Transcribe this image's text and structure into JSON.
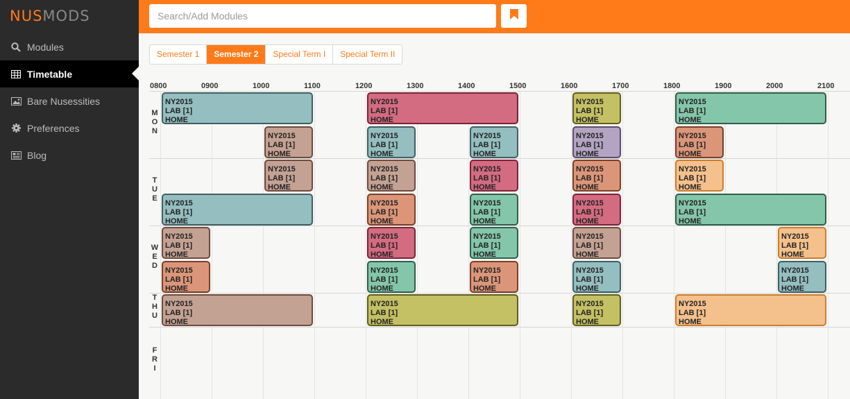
{
  "sidebar": {
    "brand": {
      "left": "NUS",
      "right": "MODS"
    },
    "items": [
      {
        "label": "Modules",
        "icon": "search-icon",
        "active": false
      },
      {
        "label": "Timetable",
        "icon": "table-icon",
        "active": true
      },
      {
        "label": "Bare Nusessities",
        "icon": "image-icon",
        "active": false
      },
      {
        "label": "Preferences",
        "icon": "gear-icon",
        "active": false
      },
      {
        "label": "Blog",
        "icon": "newspaper-icon",
        "active": false
      }
    ]
  },
  "topbar": {
    "search_placeholder": "Search/Add Modules",
    "bookmark_icon": "bookmark-icon",
    "accent": "#ff7b1a"
  },
  "tabs": [
    {
      "label": "Semester 1",
      "active": false
    },
    {
      "label": "Semester 2",
      "active": true
    },
    {
      "label": "Special Term I",
      "active": false
    },
    {
      "label": "Special Term II",
      "active": false
    }
  ],
  "timetable": {
    "hours": [
      "0800",
      "0900",
      "1000",
      "1100",
      "1200",
      "1300",
      "1400",
      "1500",
      "1600",
      "1700",
      "1800",
      "1900",
      "2000",
      "2100"
    ],
    "days": [
      {
        "label": "MON",
        "rows": 2
      },
      {
        "label": "TUE",
        "rows": 2
      },
      {
        "label": "WED",
        "rows": 2
      },
      {
        "label": "THU",
        "rows": 1
      },
      {
        "label": "FRI",
        "rows": 1
      }
    ],
    "lessons": [
      {
        "day": 0,
        "row": 0,
        "start": 800,
        "end": 1100,
        "color": "teal",
        "lines": [
          "NY2015",
          "LAB [1]",
          "HOME"
        ]
      },
      {
        "day": 0,
        "row": 0,
        "start": 1200,
        "end": 1500,
        "color": "red",
        "lines": [
          "NY2015",
          "LAB [1]",
          "HOME"
        ]
      },
      {
        "day": 0,
        "row": 0,
        "start": 1600,
        "end": 1700,
        "color": "olive",
        "lines": [
          "NY2015",
          "LAB [1]",
          "HOME"
        ]
      },
      {
        "day": 0,
        "row": 0,
        "start": 1800,
        "end": 2100,
        "color": "green",
        "lines": [
          "NY2015",
          "LAB [1]",
          "HOME"
        ]
      },
      {
        "day": 0,
        "row": 1,
        "start": 1000,
        "end": 1100,
        "color": "tan",
        "lines": [
          "NY2015",
          "LAB [1]",
          "HOME"
        ]
      },
      {
        "day": 0,
        "row": 1,
        "start": 1200,
        "end": 1300,
        "color": "teal",
        "lines": [
          "NY2015",
          "LAB [1]",
          "HOME"
        ]
      },
      {
        "day": 0,
        "row": 1,
        "start": 1400,
        "end": 1500,
        "color": "teal",
        "lines": [
          "NY2015",
          "LAB [1]",
          "HOME"
        ]
      },
      {
        "day": 0,
        "row": 1,
        "start": 1600,
        "end": 1700,
        "color": "purple",
        "lines": [
          "NY2015",
          "LAB [1]",
          "HOME"
        ]
      },
      {
        "day": 0,
        "row": 1,
        "start": 1800,
        "end": 1900,
        "color": "salmon",
        "lines": [
          "NY2015",
          "LAB [1]",
          "HOME"
        ]
      },
      {
        "day": 1,
        "row": 0,
        "start": 1000,
        "end": 1100,
        "color": "tan",
        "lines": [
          "NY2015",
          "LAB [1]",
          "HOME"
        ]
      },
      {
        "day": 1,
        "row": 0,
        "start": 1200,
        "end": 1300,
        "color": "tan",
        "lines": [
          "NY2015",
          "LAB [1]",
          "HOME"
        ]
      },
      {
        "day": 1,
        "row": 0,
        "start": 1400,
        "end": 1500,
        "color": "red",
        "lines": [
          "NY2015",
          "LAB [1]",
          "HOME"
        ]
      },
      {
        "day": 1,
        "row": 0,
        "start": 1600,
        "end": 1700,
        "color": "salmon",
        "lines": [
          "NY2015",
          "LAB [1]",
          "HOME"
        ]
      },
      {
        "day": 1,
        "row": 0,
        "start": 1800,
        "end": 1900,
        "color": "peach",
        "lines": [
          "NY2015",
          "LAB [1]",
          "HOME"
        ]
      },
      {
        "day": 1,
        "row": 1,
        "start": 800,
        "end": 1100,
        "color": "teal",
        "lines": [
          "NY2015",
          "LAB [1]",
          "HOME"
        ]
      },
      {
        "day": 1,
        "row": 1,
        "start": 1200,
        "end": 1300,
        "color": "salmon",
        "lines": [
          "NY2015",
          "LAB [1]",
          "HOME"
        ]
      },
      {
        "day": 1,
        "row": 1,
        "start": 1400,
        "end": 1500,
        "color": "green",
        "lines": [
          "NY2015",
          "LAB [1]",
          "HOME"
        ]
      },
      {
        "day": 1,
        "row": 1,
        "start": 1600,
        "end": 1700,
        "color": "red",
        "lines": [
          "NY2015",
          "LAB [1]",
          "HOME"
        ]
      },
      {
        "day": 1,
        "row": 1,
        "start": 1800,
        "end": 2100,
        "color": "green",
        "lines": [
          "NY2015",
          "LAB [1]",
          "HOME"
        ]
      },
      {
        "day": 2,
        "row": 0,
        "start": 800,
        "end": 900,
        "color": "tan",
        "lines": [
          "NY2015",
          "LAB [1]",
          "HOME"
        ]
      },
      {
        "day": 2,
        "row": 0,
        "start": 1200,
        "end": 1300,
        "color": "red",
        "lines": [
          "NY2015",
          "LAB [1]",
          "HOME"
        ]
      },
      {
        "day": 2,
        "row": 0,
        "start": 1400,
        "end": 1500,
        "color": "green",
        "lines": [
          "NY2015",
          "LAB [1]",
          "HOME"
        ]
      },
      {
        "day": 2,
        "row": 0,
        "start": 1600,
        "end": 1700,
        "color": "tan",
        "lines": [
          "NY2015",
          "LAB [1]",
          "HOME"
        ]
      },
      {
        "day": 2,
        "row": 0,
        "start": 2000,
        "end": 2100,
        "color": "peach",
        "lines": [
          "NY2015",
          "LAB [1]",
          "HOME"
        ]
      },
      {
        "day": 2,
        "row": 1,
        "start": 800,
        "end": 900,
        "color": "salmon",
        "lines": [
          "NY2015",
          "LAB [1]",
          "HOME"
        ]
      },
      {
        "day": 2,
        "row": 1,
        "start": 1200,
        "end": 1300,
        "color": "green",
        "lines": [
          "NY2015",
          "LAB [1]",
          "HOME"
        ]
      },
      {
        "day": 2,
        "row": 1,
        "start": 1400,
        "end": 1500,
        "color": "salmon",
        "lines": [
          "NY2015",
          "LAB [1]",
          "HOME"
        ]
      },
      {
        "day": 2,
        "row": 1,
        "start": 1600,
        "end": 1700,
        "color": "teal",
        "lines": [
          "NY2015",
          "LAB [1]",
          "HOME"
        ]
      },
      {
        "day": 2,
        "row": 1,
        "start": 2000,
        "end": 2100,
        "color": "teal",
        "lines": [
          "NY2015",
          "LAB [1]",
          "HOME"
        ]
      },
      {
        "day": 3,
        "row": 0,
        "start": 800,
        "end": 1100,
        "color": "tan",
        "lines": [
          "NY2015",
          "LAB [1]",
          "HOME"
        ]
      },
      {
        "day": 3,
        "row": 0,
        "start": 1200,
        "end": 1500,
        "color": "olive",
        "lines": [
          "NY2015",
          "LAB [1]",
          "HOME"
        ]
      },
      {
        "day": 3,
        "row": 0,
        "start": 1600,
        "end": 1700,
        "color": "olive",
        "lines": [
          "NY2015",
          "LAB [1]",
          "HOME"
        ]
      },
      {
        "day": 3,
        "row": 0,
        "start": 1800,
        "end": 2100,
        "color": "peach",
        "lines": [
          "NY2015",
          "LAB [1]",
          "HOME"
        ]
      }
    ],
    "palette": {
      "teal": {
        "bg": "#94bec0",
        "border": "#3f5f61"
      },
      "red": {
        "bg": "#d36b81",
        "border": "#7b2236"
      },
      "olive": {
        "bg": "#c4c064",
        "border": "#5f5c1d"
      },
      "green": {
        "bg": "#84c6aa",
        "border": "#2f5e4a"
      },
      "tan": {
        "bg": "#c4a293",
        "border": "#6d4a3c"
      },
      "purple": {
        "bg": "#b3a4c2",
        "border": "#5a4b6b"
      },
      "salmon": {
        "bg": "#db9679",
        "border": "#7a3e25"
      },
      "peach": {
        "bg": "#f4c08c",
        "border": "#c97d2a"
      }
    }
  }
}
